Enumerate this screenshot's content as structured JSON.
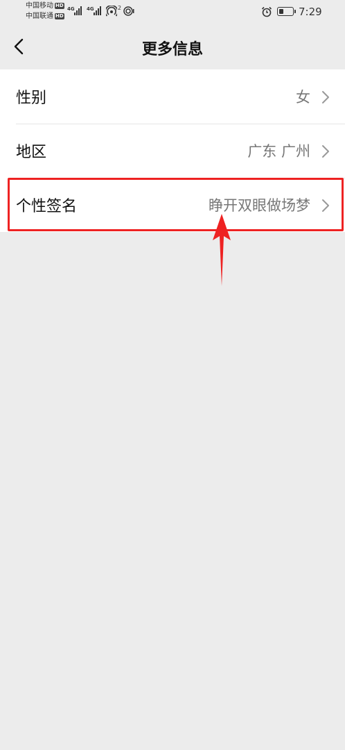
{
  "status_bar": {
    "carrier1": "中国移动",
    "carrier2": "中国联通",
    "hd_badge": "HD",
    "network1": "4G",
    "network2": "4G",
    "hotspot_count": "2",
    "time": "7:29",
    "battery_level": 0.35
  },
  "header": {
    "title": "更多信息"
  },
  "rows": [
    {
      "label": "性别",
      "value": "女"
    },
    {
      "label": "地区",
      "value": "广东 广州"
    },
    {
      "label": "个性签名",
      "value": "睁开双眼做场梦"
    }
  ],
  "colors": {
    "background": "#ececec",
    "row_background": "#ffffff",
    "annotation_red": "#ee2222"
  }
}
